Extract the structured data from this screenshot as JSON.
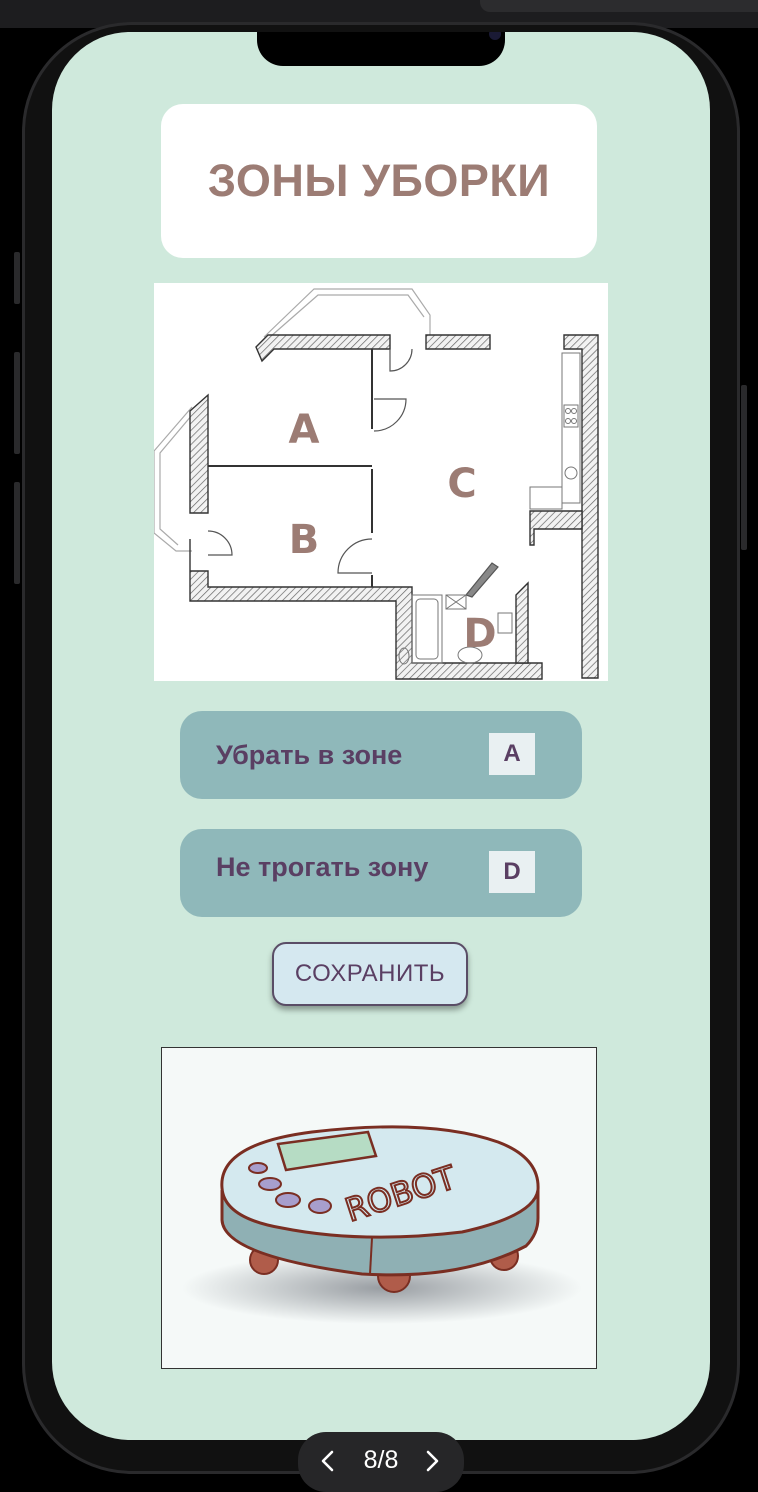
{
  "screen": {
    "title": "ЗОНЫ УБОРКИ",
    "floorplan": {
      "zones": [
        {
          "label": "A"
        },
        {
          "label": "B"
        },
        {
          "label": "C"
        },
        {
          "label": "D"
        }
      ]
    },
    "actions": [
      {
        "label": "Убрать в зоне",
        "zone": "A"
      },
      {
        "label": "Не трогать зону",
        "zone": "D"
      }
    ],
    "save_label": "СОХРАНИТЬ",
    "robot_image": {
      "text": "ROBOT"
    }
  },
  "pager": {
    "text": "8/8"
  },
  "colors": {
    "screen_bg": "#cfe9dc",
    "title_text": "#9c7c74",
    "card_bg": "#8fb8ba",
    "card_text": "#5a3f63",
    "button_bg": "#d5e8f0"
  }
}
